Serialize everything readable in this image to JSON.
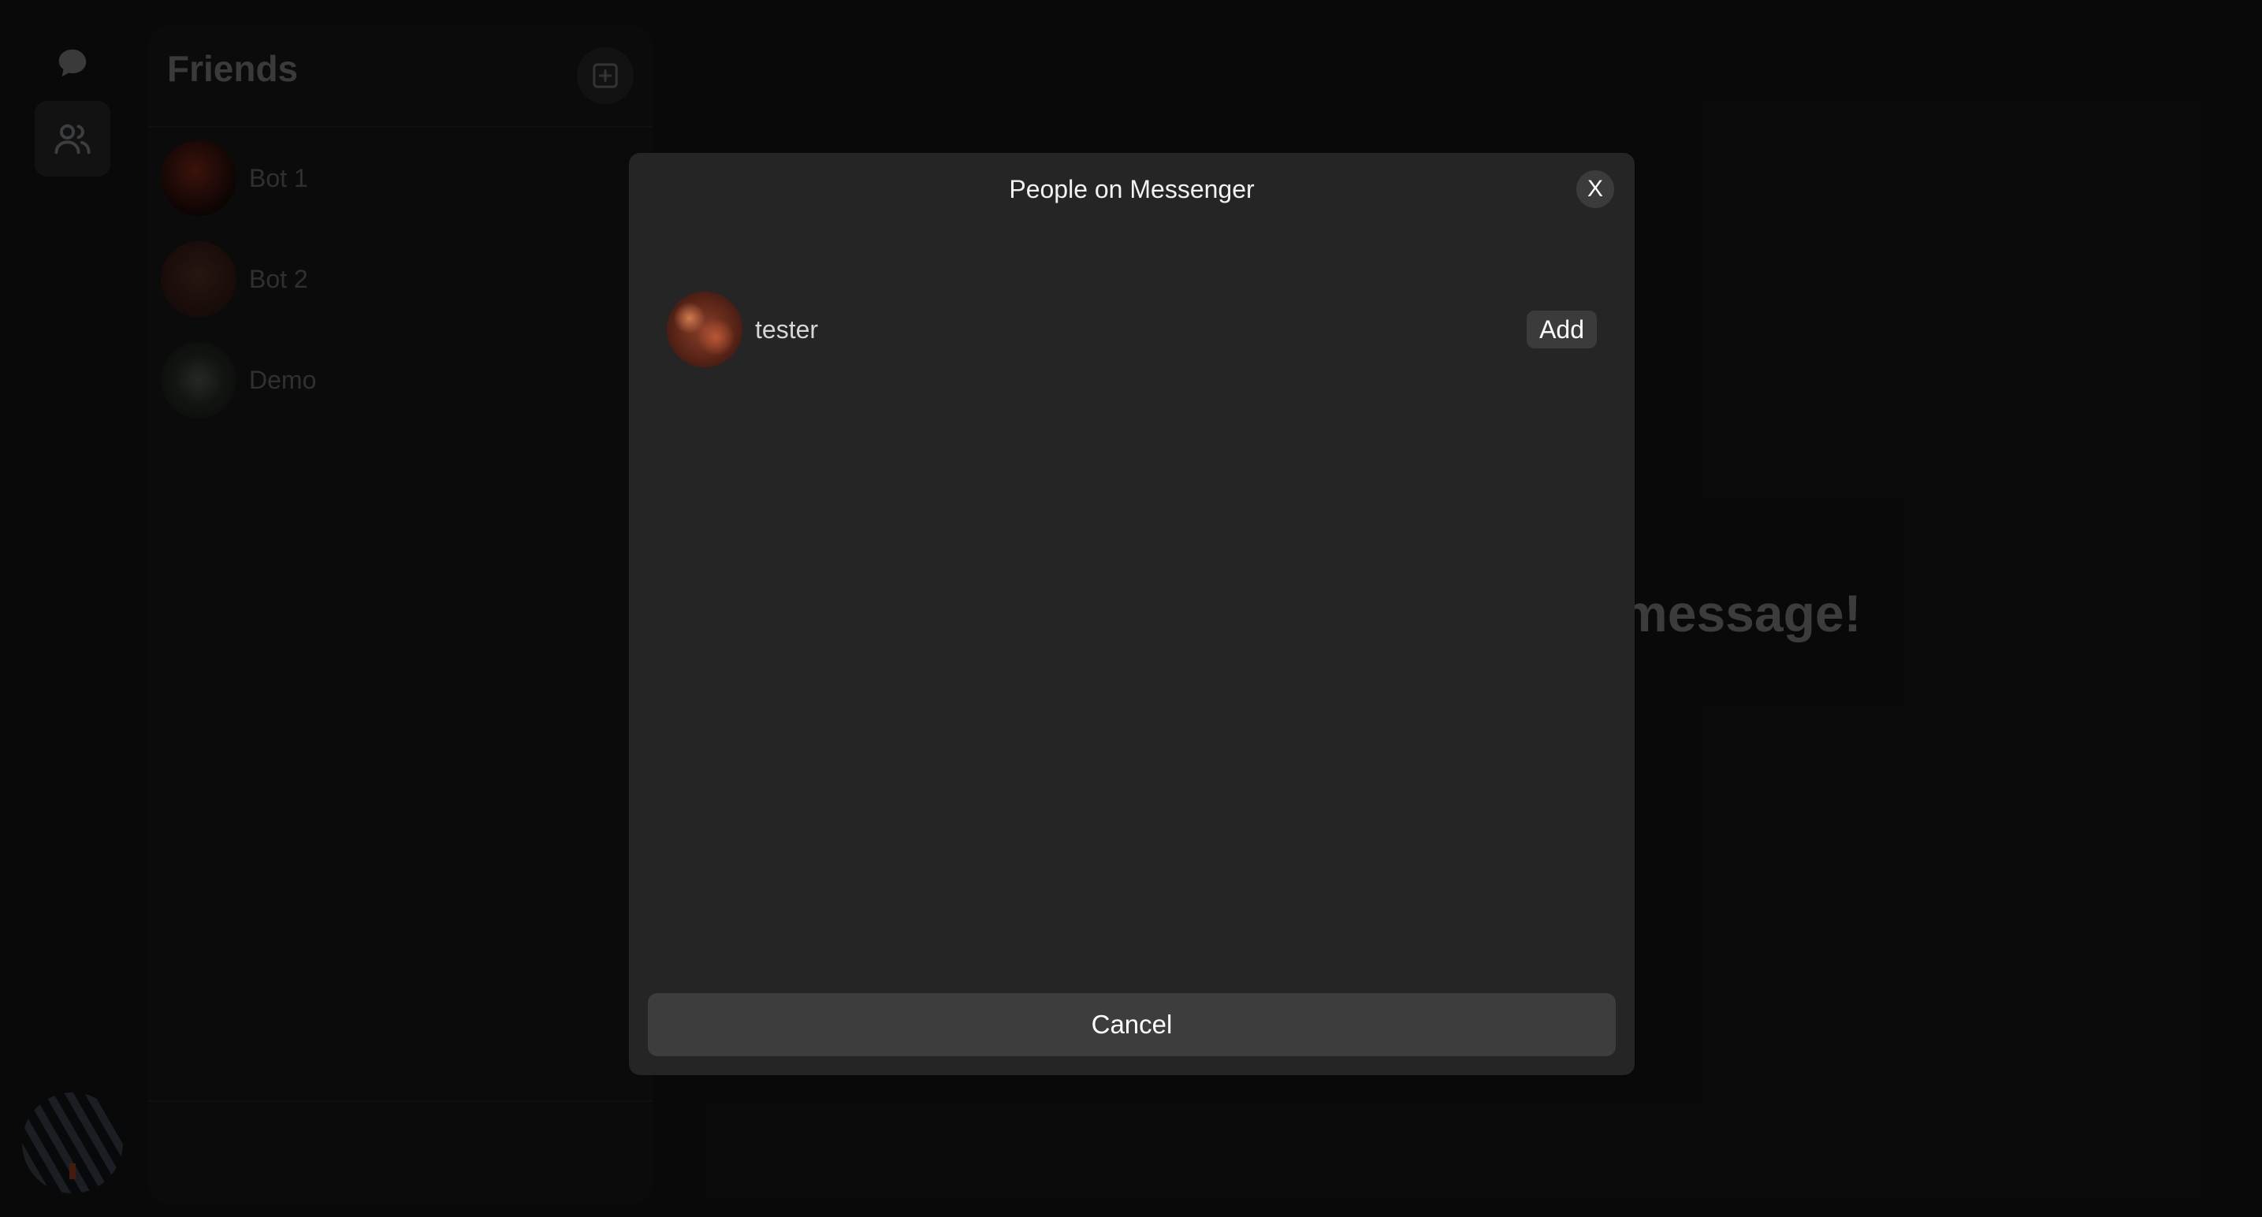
{
  "rail": {
    "chats_icon": "chat-bubble-icon",
    "people_icon": "people-icon",
    "active": "people"
  },
  "friends": {
    "title": "Friends",
    "add_icon": "plus-square-icon",
    "items": [
      {
        "name": "Bot 1"
      },
      {
        "name": "Bot 2"
      },
      {
        "name": "Demo"
      }
    ]
  },
  "main": {
    "placeholder": "Select a chat or start a message!"
  },
  "modal": {
    "title": "People on Messenger",
    "close_label": "X",
    "people": [
      {
        "name": "tester",
        "action": "Add"
      }
    ],
    "cancel_label": "Cancel"
  },
  "colors": {
    "modal_bg": "#252525",
    "button_bg": "#3b3b3b",
    "page_bg": "#0e0e0e"
  }
}
